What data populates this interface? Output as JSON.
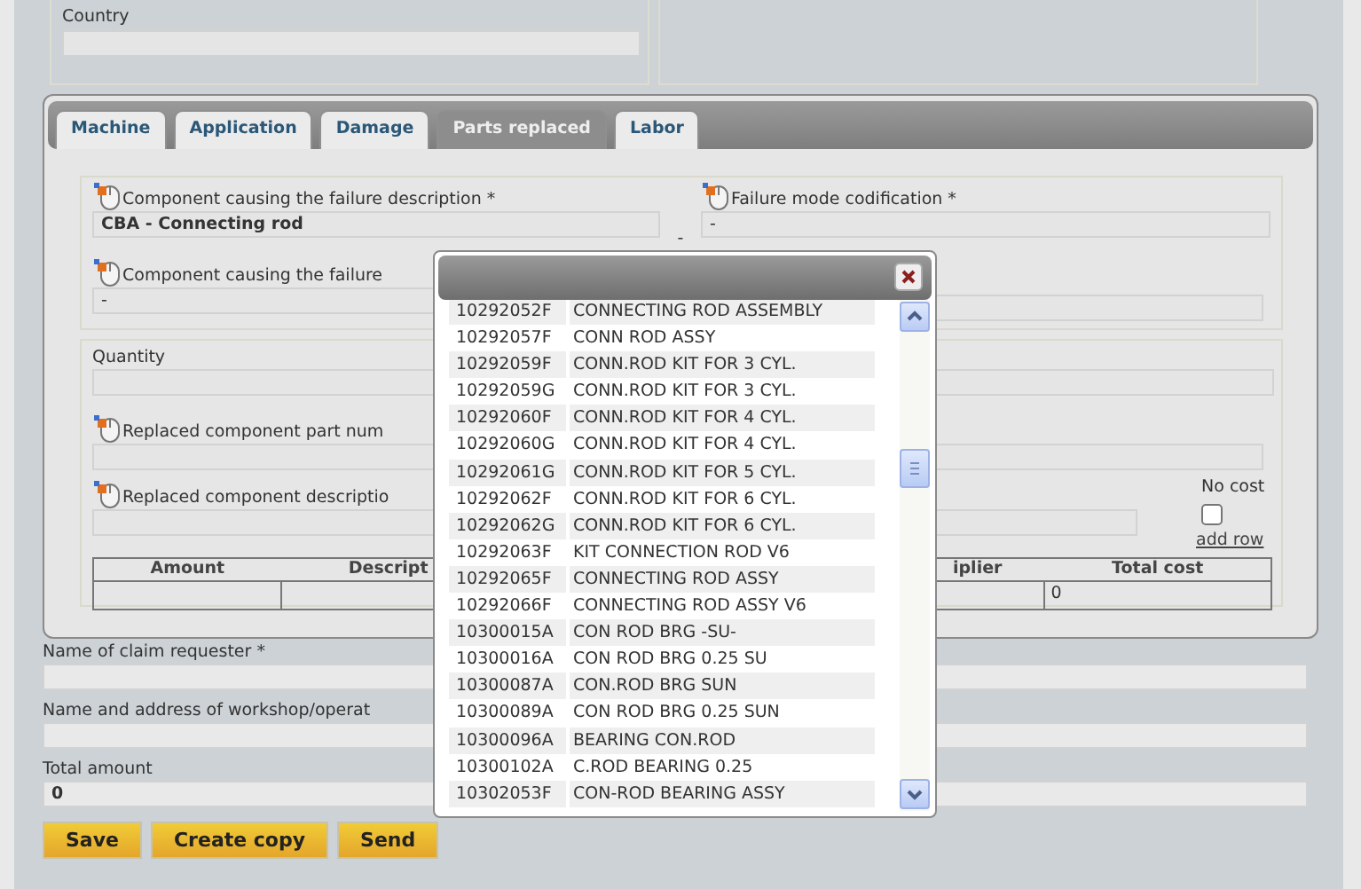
{
  "country": {
    "label": "Country"
  },
  "tabs": [
    {
      "label": "Machine",
      "selected": false
    },
    {
      "label": "Application",
      "selected": false
    },
    {
      "label": "Damage",
      "selected": false
    },
    {
      "label": "Parts replaced",
      "selected": true
    },
    {
      "label": "Labor",
      "selected": false
    }
  ],
  "failure": {
    "component_description": {
      "label": "Component causing the failure description *",
      "value": "CBA - Connecting rod"
    },
    "separator": "-",
    "failure_mode": {
      "label": "Failure mode codification *",
      "value": "-"
    },
    "component_code": {
      "label": "Component causing the failure",
      "value": "-"
    }
  },
  "parts": {
    "quantity_label": "Quantity",
    "part_number_label": "Replaced component part num",
    "description_label": "Replaced component descriptio",
    "no_cost": {
      "label": "No cost",
      "checked": false
    },
    "add_row": "add row",
    "table": {
      "columns": [
        "Amount",
        "Descript",
        "iplier",
        "Total cost"
      ],
      "rows": [
        {
          "total_cost": "0"
        }
      ]
    }
  },
  "claim": [
    {
      "label": "Name of claim requester *"
    },
    {
      "label": "Name and address of workshop/operat"
    },
    {
      "label": "Total amount",
      "value": "0"
    }
  ],
  "buttons": [
    "Save",
    "Create copy",
    "Send"
  ],
  "popup": {
    "items": [
      {
        "code": "10292052F",
        "description": "CONNECTING ROD ASSEMBLY"
      },
      {
        "code": "10292057F",
        "description": "CONN ROD ASSY"
      },
      {
        "code": "10292059F",
        "description": "CONN.ROD KIT FOR 3 CYL."
      },
      {
        "code": "10292059G",
        "description": "CONN.ROD KIT FOR 3 CYL."
      },
      {
        "code": "10292060F",
        "description": "CONN.ROD KIT FOR 4 CYL."
      },
      {
        "code": "10292060G",
        "description": "CONN.ROD KIT FOR 4 CYL."
      },
      {
        "code": "10292061G",
        "description": "CONN.ROD KIT FOR 5 CYL."
      },
      {
        "code": "10292062F",
        "description": "CONN.ROD KIT FOR 6 CYL."
      },
      {
        "code": "10292062G",
        "description": "CONN.ROD KIT FOR 6 CYL."
      },
      {
        "code": "10292063F",
        "description": "KIT CONNECTION ROD V6"
      },
      {
        "code": "10292065F",
        "description": "CONNECTING ROD ASSY"
      },
      {
        "code": "10292066F",
        "description": "CONNECTING ROD ASSY V6"
      },
      {
        "code": "10300015A",
        "description": "CON ROD BRG -SU-"
      },
      {
        "code": "10300016A",
        "description": "CON ROD BRG 0.25 SU"
      },
      {
        "code": "10300087A",
        "description": "CON.ROD BRG SUN"
      },
      {
        "code": "10300089A",
        "description": "CON ROD BRG 0.25 SUN"
      },
      {
        "code": "10300096A",
        "description": "BEARING CON.ROD"
      },
      {
        "code": "10300102A",
        "description": "C.ROD BEARING 0.25"
      },
      {
        "code": "10302053F",
        "description": "CON-ROD BEARING ASSY"
      }
    ]
  }
}
